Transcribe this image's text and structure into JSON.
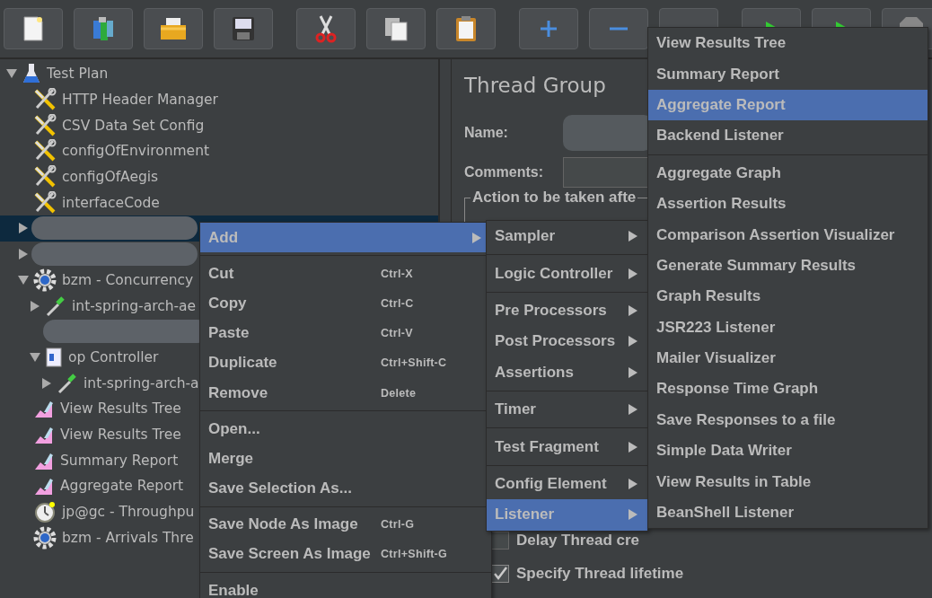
{
  "tree": [
    {
      "label": "Test Plan",
      "kind": "plan",
      "expanded": true,
      "selected": false,
      "children": [
        {
          "label": "HTTP Header Manager",
          "kind": "config",
          "selected": false
        },
        {
          "label": "CSV Data Set Config",
          "kind": "config",
          "selected": false
        },
        {
          "label": "configOfEnvironment",
          "kind": "config",
          "selected": false
        },
        {
          "label": "configOfAegis",
          "kind": "config",
          "selected": false
        },
        {
          "label": "interfaceCode",
          "kind": "config",
          "selected": false
        },
        {
          "kind": "redacted",
          "expanded": false,
          "selected": true
        },
        {
          "kind": "redacted",
          "expanded": false,
          "selected": false
        },
        {
          "label": "bzm - Concurrency",
          "kind": "thread_group",
          "expanded": true,
          "selected": false,
          "children": [
            {
              "label": "int-spring-arch-ae",
              "kind": "sampler",
              "expanded": false,
              "selected": false
            },
            {
              "kind": "redacted",
              "selected": false
            },
            {
              "label": "op Controller",
              "kind": "controller",
              "expanded": true,
              "selected": false,
              "children": [
                {
                  "label": "int-spring-arch-a",
                  "kind": "sampler",
                  "expanded": false,
                  "selected": false
                }
              ]
            }
          ]
        },
        {
          "label": "View Results Tree",
          "kind": "listener",
          "selected": false
        },
        {
          "label": "View Results Tree",
          "kind": "listener",
          "selected": false
        },
        {
          "label": "Summary Report",
          "kind": "listener",
          "selected": false
        },
        {
          "label": "Aggregate Report",
          "kind": "listener",
          "selected": false
        },
        {
          "label": "jp@gc - Throughpu",
          "kind": "timer",
          "selected": false
        },
        {
          "label": "bzm - Arrivals Thre",
          "kind": "thread_group",
          "selected": false
        }
      ]
    }
  ],
  "editor": {
    "title": "Thread Group",
    "name_label": "Name:",
    "comments_label": "Comments:",
    "group_title": "Action to be taken afte",
    "checkboxes": [
      {
        "label": "Delay Thread cre",
        "checked": false
      },
      {
        "label": "Specify Thread lifetime",
        "checked": true
      }
    ]
  },
  "context_menu": [
    {
      "kind": "item",
      "label": "Add",
      "selected": true,
      "has_submenu": true
    },
    {
      "kind": "separator"
    },
    {
      "kind": "item",
      "label": "Cut",
      "shortcut": "Ctrl-X",
      "selected": false
    },
    {
      "kind": "item",
      "label": "Copy",
      "shortcut": "Ctrl-C",
      "selected": false
    },
    {
      "kind": "item",
      "label": "Paste",
      "shortcut": "Ctrl-V",
      "selected": false
    },
    {
      "kind": "item",
      "label": "Duplicate",
      "shortcut": "Ctrl+Shift-C",
      "selected": false
    },
    {
      "kind": "item",
      "label": "Remove",
      "shortcut": "Delete",
      "selected": false
    },
    {
      "kind": "separator"
    },
    {
      "kind": "item",
      "label": "Open...",
      "selected": false
    },
    {
      "kind": "item",
      "label": "Merge",
      "selected": false
    },
    {
      "kind": "item",
      "label": "Save Selection As...",
      "selected": false
    },
    {
      "kind": "separator"
    },
    {
      "kind": "item",
      "label": "Save Node As Image",
      "shortcut": "Ctrl-G",
      "selected": false
    },
    {
      "kind": "item",
      "label": "Save Screen As Image",
      "shortcut": "Ctrl+Shift-G",
      "selected": false
    },
    {
      "kind": "separator"
    },
    {
      "kind": "item",
      "label": "Enable",
      "selected": false
    }
  ],
  "add_menu": [
    {
      "kind": "item",
      "label": "Sampler",
      "selected": false,
      "has_submenu": true
    },
    {
      "kind": "separator"
    },
    {
      "kind": "item",
      "label": "Logic Controller",
      "selected": false,
      "has_submenu": true
    },
    {
      "kind": "separator"
    },
    {
      "kind": "item",
      "label": "Pre Processors",
      "selected": false,
      "has_submenu": true
    },
    {
      "kind": "item",
      "label": "Post Processors",
      "selected": false,
      "has_submenu": true
    },
    {
      "kind": "item",
      "label": "Assertions",
      "selected": false,
      "has_submenu": true
    },
    {
      "kind": "separator"
    },
    {
      "kind": "item",
      "label": "Timer",
      "selected": false,
      "has_submenu": true
    },
    {
      "kind": "separator"
    },
    {
      "kind": "item",
      "label": "Test Fragment",
      "selected": false,
      "has_submenu": true
    },
    {
      "kind": "separator"
    },
    {
      "kind": "item",
      "label": "Config Element",
      "selected": false,
      "has_submenu": true
    },
    {
      "kind": "item",
      "label": "Listener",
      "selected": true,
      "has_submenu": true
    }
  ],
  "listener_menu": [
    {
      "kind": "item",
      "label": "View Results Tree",
      "selected": false
    },
    {
      "kind": "item",
      "label": "Summary Report",
      "selected": false
    },
    {
      "kind": "item",
      "label": "Aggregate Report",
      "selected": true
    },
    {
      "kind": "item",
      "label": "Backend Listener",
      "selected": false
    },
    {
      "kind": "separator"
    },
    {
      "kind": "item",
      "label": "Aggregate Graph",
      "selected": false
    },
    {
      "kind": "item",
      "label": "Assertion Results",
      "selected": false
    },
    {
      "kind": "item",
      "label": "Comparison Assertion Visualizer",
      "selected": false
    },
    {
      "kind": "item",
      "label": "Generate Summary Results",
      "selected": false
    },
    {
      "kind": "item",
      "label": "Graph Results",
      "selected": false
    },
    {
      "kind": "item",
      "label": "JSR223 Listener",
      "selected": false
    },
    {
      "kind": "item",
      "label": "Mailer Visualizer",
      "selected": false
    },
    {
      "kind": "item",
      "label": "Response Time Graph",
      "selected": false
    },
    {
      "kind": "item",
      "label": "Save Responses to a file",
      "selected": false
    },
    {
      "kind": "item",
      "label": "Simple Data Writer",
      "selected": false
    },
    {
      "kind": "item",
      "label": "View Results in Table",
      "selected": false
    },
    {
      "kind": "item",
      "label": "BeanShell Listener",
      "selected": false
    }
  ]
}
